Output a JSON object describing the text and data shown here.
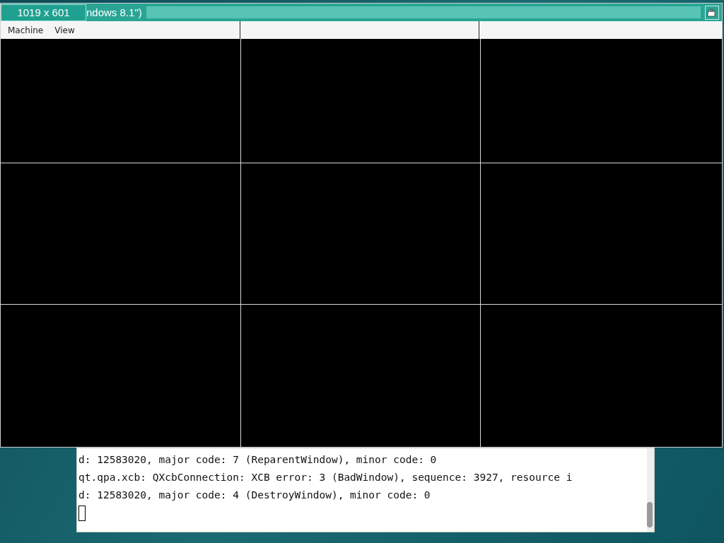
{
  "window": {
    "size_label": "1019 x 601",
    "title": "ndows 8.1\")",
    "menu": [
      {
        "label": "Machine"
      },
      {
        "label": "View"
      }
    ]
  },
  "terminal": {
    "lines": [
      "d: 12583020, major code: 7 (ReparentWindow), minor code: 0",
      "qt.qpa.xcb: QXcbConnection: XCB error: 3 (BadWindow), sequence: 3927, resource i",
      "d: 12583020, major code: 4 (DestroyWindow), minor code: 0"
    ]
  }
}
